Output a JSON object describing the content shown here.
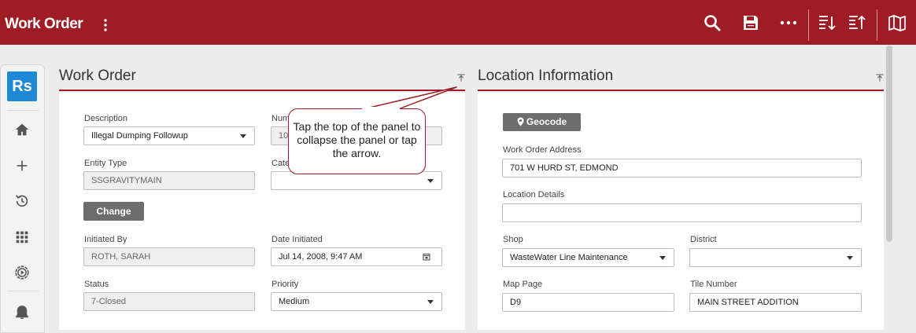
{
  "header": {
    "title": "Work Order",
    "icons": [
      "kebab-menu-icon",
      "search-icon",
      "save-icon",
      "more-icon",
      "sort-descending-icon",
      "sort-ascending-icon",
      "map-icon"
    ]
  },
  "sidebar": {
    "logo": "Rs",
    "icons": [
      "home-icon",
      "add-icon",
      "history-icon",
      "apps-grid-icon",
      "settings-icon",
      "bell-icon"
    ]
  },
  "work_order": {
    "title": "Work Order",
    "description_label": "Description",
    "description_value": "Illegal Dumping Followup",
    "number_label": "Num",
    "number_value": "10",
    "entity_type_label": "Entity Type",
    "entity_type_value": "SSGRAVITYMAIN",
    "category_label": "Cate",
    "category_value": "",
    "change_button": "Change",
    "initiated_by_label": "Initiated By",
    "initiated_by_value": "ROTH, SARAH",
    "date_initiated_label": "Date Initiated",
    "date_initiated_value": "Jul 14, 2008, 9:47 AM",
    "status_label": "Status",
    "status_value": "7-Closed",
    "priority_label": "Priority",
    "priority_value": "Medium"
  },
  "location": {
    "title": "Location Information",
    "geocode_button": "Geocode",
    "address_label": "Work Order Address",
    "address_value": "701 W HURD ST,  EDMOND",
    "details_label": "Location Details",
    "details_value": "",
    "shop_label": "Shop",
    "shop_value": "WasteWater Line Maintenance",
    "district_label": "District",
    "district_value": "",
    "map_page_label": "Map Page",
    "map_page_value": "D9",
    "tile_number_label": "Tile Number",
    "tile_number_value": "MAIN STREET ADDITION"
  },
  "callout": {
    "text": "Tap the top of the panel to collapse the panel or tap the arrow."
  },
  "colors": {
    "brand": "#a01c25",
    "logo": "#1e88d4",
    "button": "#6d6d6d"
  }
}
